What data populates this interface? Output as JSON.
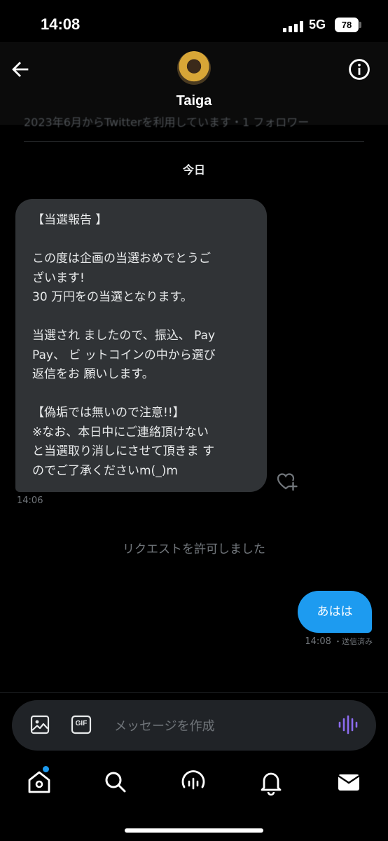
{
  "status_bar": {
    "time": "14:08",
    "network": "5G",
    "battery": "78"
  },
  "header": {
    "contact_name": "Taiga",
    "faded_line": "2023年6月からTwitterを利用しています・1 フォロワー"
  },
  "conversation": {
    "date_separator": "今日",
    "incoming": {
      "lines": [
        "【当選報告 】",
        "",
        "この度は企画の当選おめでとうご",
        "ざいます!",
        "30 万円をの当選となります。",
        "",
        "当選され ましたので、振込、 Pay",
        "Pay、 ビ ットコインの中から選び",
        "返信をお 願いします。",
        "",
        "【偽垢では無いので注意!!】",
        "※なお、本日中にご連絡頂けない",
        "と当選取り消しにさせて頂きま す",
        "のでご了承くださいm(_)m"
      ],
      "time": "14:06"
    },
    "system_note": "リクエストを許可しました",
    "outgoing": {
      "text": "あはは",
      "time": "14:08",
      "status": "・送信済み"
    }
  },
  "compose": {
    "placeholder": "メッセージを作成",
    "gif_label": "GIF"
  },
  "tab_bar": {
    "items": [
      "home-icon",
      "search-icon",
      "spaces-icon",
      "notifications-icon",
      "messages-icon"
    ],
    "home_badge_color": "#1d9bf0"
  },
  "colors": {
    "accent": "#1d9bf0",
    "incoming_bubble": "#303336",
    "muted_text": "#71767b",
    "voice_icon": "#8c6cf0"
  }
}
